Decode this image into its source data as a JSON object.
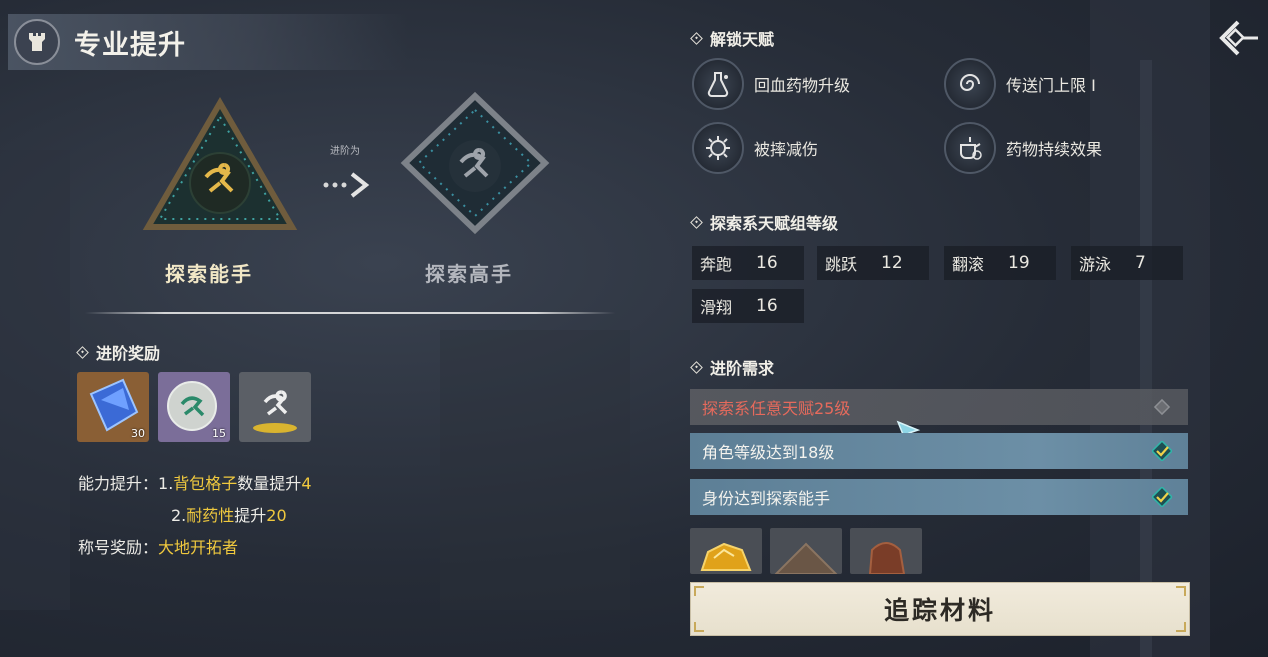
{
  "header": {
    "title": "专业提升"
  },
  "ranks": {
    "current": "探索能手",
    "next": "探索高手",
    "advance_label": "进阶为"
  },
  "rewards": {
    "title": "进阶奖励",
    "items": [
      {
        "icon": "blue-crystal-icon",
        "count": "30"
      },
      {
        "icon": "explore-token-icon",
        "count": "15"
      },
      {
        "icon": "runner-title-icon",
        "count": ""
      }
    ],
    "ability_label": "能力提升：",
    "ability_1_prefix": "1.",
    "ability_1_gold": "背包格子",
    "ability_1_white": "数量提升",
    "ability_1_num": "4",
    "ability_2_prefix": "2.",
    "ability_2_gold": "耐药性",
    "ability_2_white": "提升",
    "ability_2_num": "20",
    "title_label": "称号奖励：",
    "title_value": "大地开拓者"
  },
  "talents": {
    "title": "解锁天赋",
    "items": [
      {
        "label": "回血药物升级",
        "icon": "potion-flask-icon"
      },
      {
        "label": "传送门上限 I",
        "icon": "portal-swirl-icon"
      },
      {
        "label": "被摔减伤",
        "icon": "gear-shield-icon"
      },
      {
        "label": "药物持续效果",
        "icon": "teapot-timer-icon"
      }
    ]
  },
  "skills": {
    "title": "探索系天赋组等级",
    "items": [
      {
        "name": "奔跑",
        "level": "16"
      },
      {
        "name": "跳跃",
        "level": "12"
      },
      {
        "name": "翻滚",
        "level": "19"
      },
      {
        "name": "游泳",
        "level": "7"
      },
      {
        "name": "滑翔",
        "level": "16"
      }
    ]
  },
  "requirements": {
    "title": "进阶需求",
    "items": [
      {
        "text": "探索系任意天赋25级",
        "done": false
      },
      {
        "text": "角色等级达到18级",
        "done": true
      },
      {
        "text": "身份达到探索能手",
        "done": true
      }
    ]
  },
  "materials": [
    {
      "icon": "gold-ore-icon"
    },
    {
      "icon": "rock-pile-icon"
    },
    {
      "icon": "bronze-ore-icon"
    }
  ],
  "track_button": "追踪材料",
  "colors": {
    "gold": "#f0c93e",
    "fail_red": "#e66a5c",
    "ok_blue": "#6c8fa6",
    "check_teal": "#2fb6a9"
  }
}
